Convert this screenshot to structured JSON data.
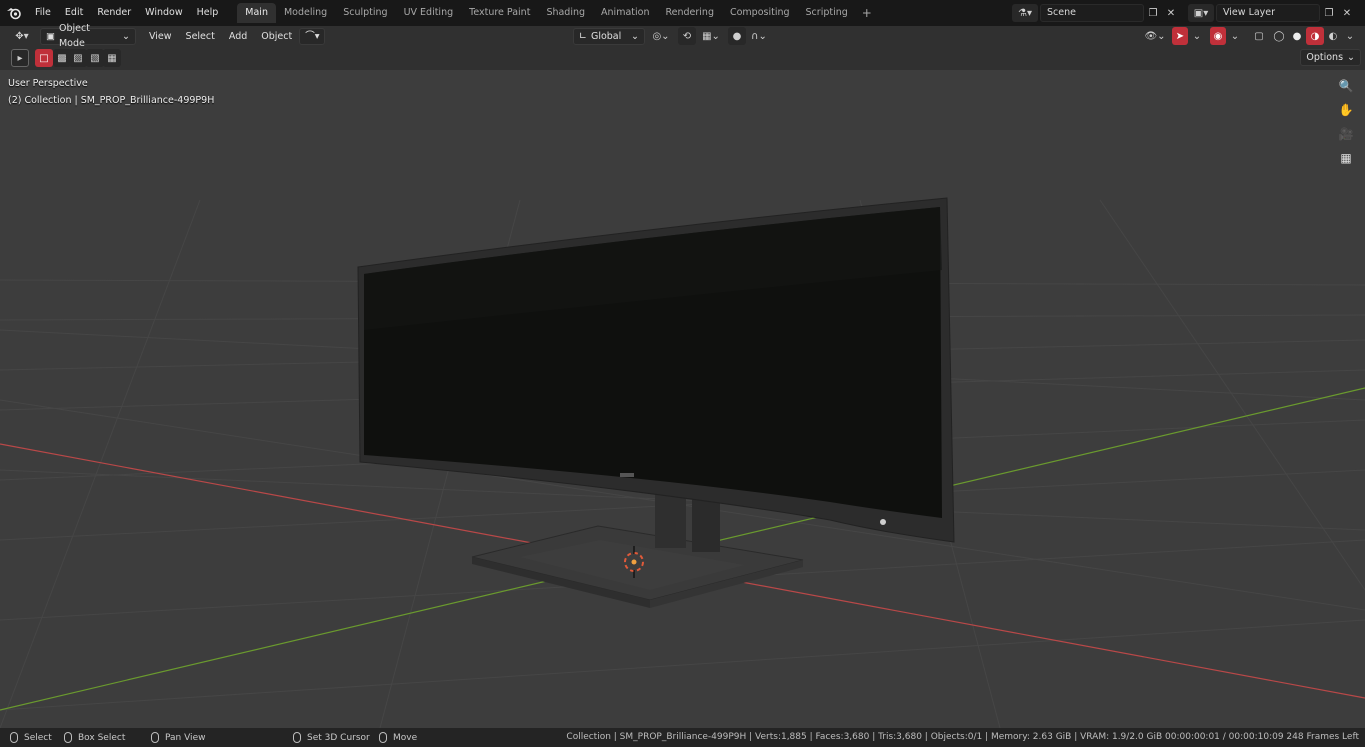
{
  "menubar": {
    "items": [
      "File",
      "Edit",
      "Render",
      "Window",
      "Help"
    ],
    "workspaces": [
      "Main",
      "Modeling",
      "Sculpting",
      "UV Editing",
      "Texture Paint",
      "Shading",
      "Animation",
      "Rendering",
      "Compositing",
      "Scripting"
    ],
    "active_workspace": "Main",
    "add_tab": "+",
    "scene": "Scene",
    "view_layer": "View Layer"
  },
  "header": {
    "mode": "Object Mode",
    "menus": [
      "View",
      "Select",
      "Add",
      "Object"
    ],
    "transform_orientation": "Global",
    "options": "Options"
  },
  "viewport": {
    "perspective": "User Perspective",
    "collection_info": "(2) Collection | SM_PROP_Brilliance-499P9H",
    "colors": {
      "x_axis": "#c24a4a",
      "y_axis": "#6a9e2e",
      "grid": "#4a4a4a",
      "background": "#3d3d3d"
    }
  },
  "statusbar": {
    "select": "Select",
    "box_select": "Box Select",
    "pan_view": "Pan View",
    "set_cursor": "Set 3D Cursor",
    "move": "Move",
    "stats": "Collection | SM_PROP_Brilliance-499P9H | Verts:1,885 | Faces:3,680 | Tris:3,680 | Objects:0/1 | Memory: 2.63 GiB | VRAM: 1.9/2.0 GiB  00:00:00:01 / 00:00:10:09  248 Frames Left"
  }
}
